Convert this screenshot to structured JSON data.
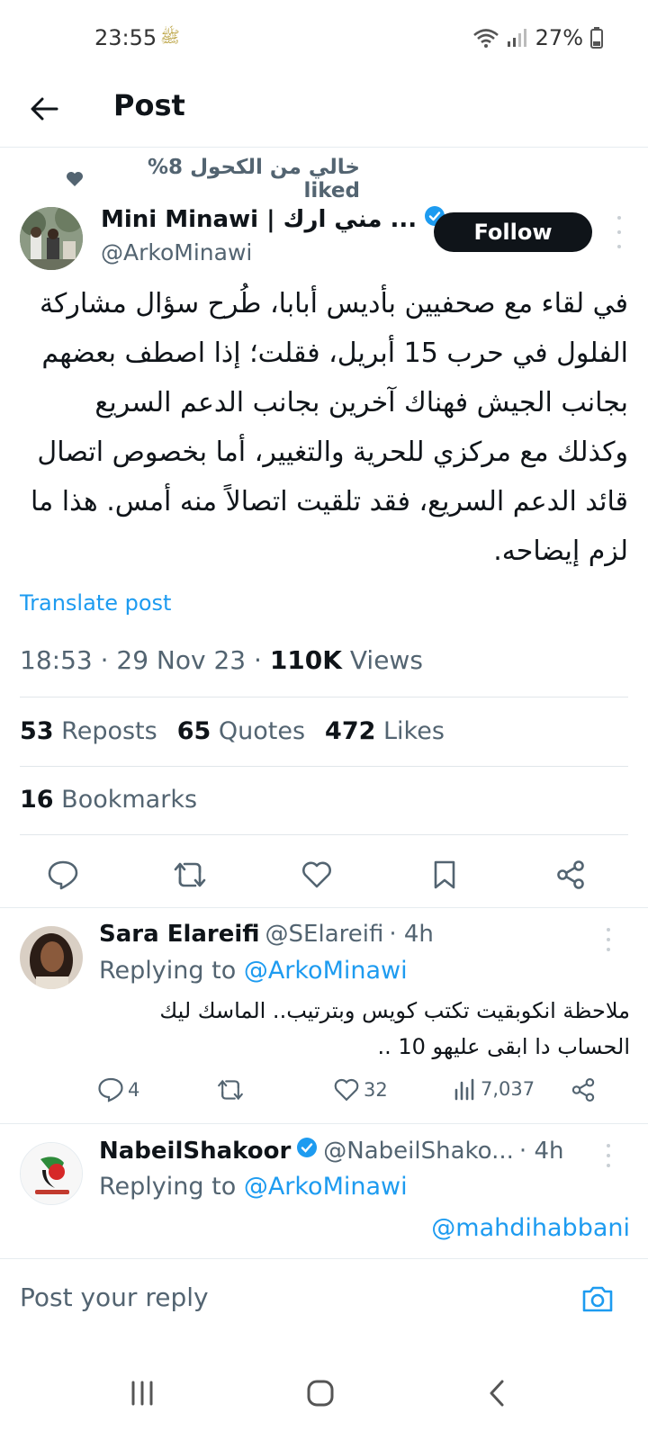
{
  "status_bar": {
    "time": "23:55",
    "extra": "ﷺ",
    "battery": "27%"
  },
  "header": {
    "title": "Post"
  },
  "social_context": "خالي من الكحول 8% liked",
  "post": {
    "author_name": "Mini Minawi | مني ارك ...",
    "author_handle": "@ArkoMinawi",
    "follow_label": "Follow",
    "text": "في لقاء مع صحفيين بأديس أبابا، طُرح سؤال مشاركة الفلول في حرب 15 أبريل، فقلت؛ إذا اصطف بعضهم بجانب الجيش فهناك آخرين بجانب الدعم السريع وكذلك مع مركزي للحرية والتغيير، أما بخصوص اتصال قائد الدعم السريع، فقد تلقيت اتصالاً منه أمس. هذا ما لزم إيضاحه.",
    "translate_label": "Translate post",
    "time": "18:53 · 29 Nov 23 · ",
    "views_count": "110K",
    "views_label": " Views",
    "reposts_count": "53",
    "reposts_label": "Reposts",
    "quotes_count": "65",
    "quotes_label": "Quotes",
    "likes_count": "472",
    "likes_label": "Likes",
    "bookmarks_count": "16",
    "bookmarks_label": "Bookmarks"
  },
  "replies": [
    {
      "name": "Sara Elareifi",
      "handle": "@SElareifi",
      "time": "· 4h",
      "replying_label": "Replying to",
      "replying_to": "@ArkoMinawi",
      "text": "ملاحظة انكوبقيت تكتب كويس وبترتيب.. الماسك ليك الحساب دا ابقى عليهو 10 ..",
      "replies_count": "4",
      "likes_count": "32",
      "views_count": "7,037"
    },
    {
      "name": "NabeilShakoor",
      "handle": "@NabeilShako...",
      "time": "· 4h",
      "replying_label": "Replying to",
      "replying_to": "@ArkoMinawi",
      "text": "@mahdihabbani"
    }
  ],
  "reply_bar": {
    "placeholder": "Post your reply"
  },
  "colors": {
    "accent": "#1d9bf0",
    "text": "#0f1419",
    "secondary": "#536471",
    "follow_bg": "#0f1419"
  }
}
